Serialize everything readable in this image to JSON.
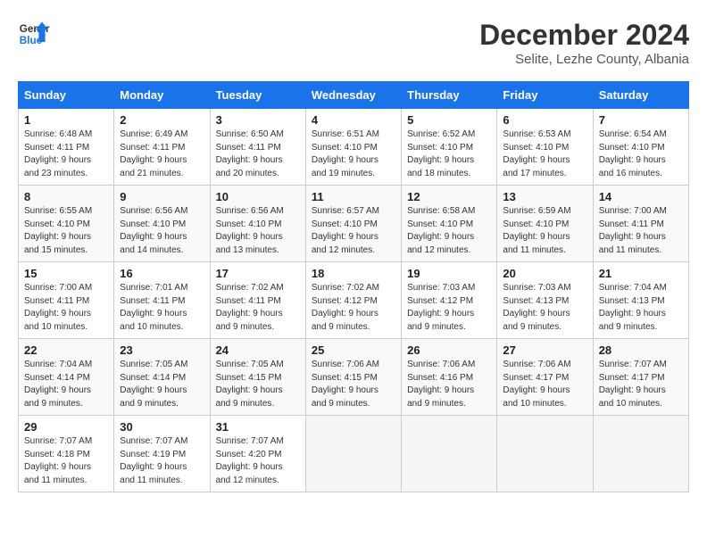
{
  "header": {
    "logo_line1": "General",
    "logo_line2": "Blue",
    "title": "December 2024",
    "subtitle": "Selite, Lezhe County, Albania"
  },
  "days_of_week": [
    "Sunday",
    "Monday",
    "Tuesday",
    "Wednesday",
    "Thursday",
    "Friday",
    "Saturday"
  ],
  "weeks": [
    [
      {
        "day": "1",
        "sunrise": "6:48 AM",
        "sunset": "4:11 PM",
        "daylight": "9 hours and 23 minutes."
      },
      {
        "day": "2",
        "sunrise": "6:49 AM",
        "sunset": "4:11 PM",
        "daylight": "9 hours and 21 minutes."
      },
      {
        "day": "3",
        "sunrise": "6:50 AM",
        "sunset": "4:11 PM",
        "daylight": "9 hours and 20 minutes."
      },
      {
        "day": "4",
        "sunrise": "6:51 AM",
        "sunset": "4:10 PM",
        "daylight": "9 hours and 19 minutes."
      },
      {
        "day": "5",
        "sunrise": "6:52 AM",
        "sunset": "4:10 PM",
        "daylight": "9 hours and 18 minutes."
      },
      {
        "day": "6",
        "sunrise": "6:53 AM",
        "sunset": "4:10 PM",
        "daylight": "9 hours and 17 minutes."
      },
      {
        "day": "7",
        "sunrise": "6:54 AM",
        "sunset": "4:10 PM",
        "daylight": "9 hours and 16 minutes."
      }
    ],
    [
      {
        "day": "8",
        "sunrise": "6:55 AM",
        "sunset": "4:10 PM",
        "daylight": "9 hours and 15 minutes."
      },
      {
        "day": "9",
        "sunrise": "6:56 AM",
        "sunset": "4:10 PM",
        "daylight": "9 hours and 14 minutes."
      },
      {
        "day": "10",
        "sunrise": "6:56 AM",
        "sunset": "4:10 PM",
        "daylight": "9 hours and 13 minutes."
      },
      {
        "day": "11",
        "sunrise": "6:57 AM",
        "sunset": "4:10 PM",
        "daylight": "9 hours and 12 minutes."
      },
      {
        "day": "12",
        "sunrise": "6:58 AM",
        "sunset": "4:10 PM",
        "daylight": "9 hours and 12 minutes."
      },
      {
        "day": "13",
        "sunrise": "6:59 AM",
        "sunset": "4:10 PM",
        "daylight": "9 hours and 11 minutes."
      },
      {
        "day": "14",
        "sunrise": "7:00 AM",
        "sunset": "4:11 PM",
        "daylight": "9 hours and 11 minutes."
      }
    ],
    [
      {
        "day": "15",
        "sunrise": "7:00 AM",
        "sunset": "4:11 PM",
        "daylight": "9 hours and 10 minutes."
      },
      {
        "day": "16",
        "sunrise": "7:01 AM",
        "sunset": "4:11 PM",
        "daylight": "9 hours and 10 minutes."
      },
      {
        "day": "17",
        "sunrise": "7:02 AM",
        "sunset": "4:11 PM",
        "daylight": "9 hours and 9 minutes."
      },
      {
        "day": "18",
        "sunrise": "7:02 AM",
        "sunset": "4:12 PM",
        "daylight": "9 hours and 9 minutes."
      },
      {
        "day": "19",
        "sunrise": "7:03 AM",
        "sunset": "4:12 PM",
        "daylight": "9 hours and 9 minutes."
      },
      {
        "day": "20",
        "sunrise": "7:03 AM",
        "sunset": "4:13 PM",
        "daylight": "9 hours and 9 minutes."
      },
      {
        "day": "21",
        "sunrise": "7:04 AM",
        "sunset": "4:13 PM",
        "daylight": "9 hours and 9 minutes."
      }
    ],
    [
      {
        "day": "22",
        "sunrise": "7:04 AM",
        "sunset": "4:14 PM",
        "daylight": "9 hours and 9 minutes."
      },
      {
        "day": "23",
        "sunrise": "7:05 AM",
        "sunset": "4:14 PM",
        "daylight": "9 hours and 9 minutes."
      },
      {
        "day": "24",
        "sunrise": "7:05 AM",
        "sunset": "4:15 PM",
        "daylight": "9 hours and 9 minutes."
      },
      {
        "day": "25",
        "sunrise": "7:06 AM",
        "sunset": "4:15 PM",
        "daylight": "9 hours and 9 minutes."
      },
      {
        "day": "26",
        "sunrise": "7:06 AM",
        "sunset": "4:16 PM",
        "daylight": "9 hours and 9 minutes."
      },
      {
        "day": "27",
        "sunrise": "7:06 AM",
        "sunset": "4:17 PM",
        "daylight": "9 hours and 10 minutes."
      },
      {
        "day": "28",
        "sunrise": "7:07 AM",
        "sunset": "4:17 PM",
        "daylight": "9 hours and 10 minutes."
      }
    ],
    [
      {
        "day": "29",
        "sunrise": "7:07 AM",
        "sunset": "4:18 PM",
        "daylight": "9 hours and 11 minutes."
      },
      {
        "day": "30",
        "sunrise": "7:07 AM",
        "sunset": "4:19 PM",
        "daylight": "9 hours and 11 minutes."
      },
      {
        "day": "31",
        "sunrise": "7:07 AM",
        "sunset": "4:20 PM",
        "daylight": "9 hours and 12 minutes."
      },
      null,
      null,
      null,
      null
    ]
  ]
}
